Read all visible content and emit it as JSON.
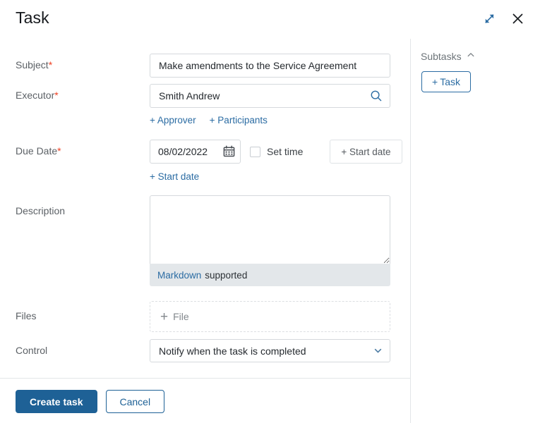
{
  "header": {
    "title": "Task",
    "expand_icon": "expand-diagonal-icon",
    "close_icon": "close-icon"
  },
  "form": {
    "subject": {
      "label": "Subject",
      "required_mark": "*",
      "value": "Make amendments to the Service Agreement",
      "placeholder": ""
    },
    "executor": {
      "label": "Executor",
      "required_mark": "*",
      "value": "Smith Andrew",
      "placeholder": "",
      "search_icon": "search-icon",
      "links": [
        {
          "label": "+ Approver"
        },
        {
          "label": "+ Participants"
        }
      ]
    },
    "due_date": {
      "label": "Due Date",
      "required_mark": "*",
      "value": "08/02/2022",
      "calendar_icon": "calendar-icon",
      "set_time_label": "Set time",
      "set_time_checked": false,
      "start_date_button": "+ Start date",
      "start_date_link": "+ Start date"
    },
    "description": {
      "label": "Description",
      "value": "",
      "placeholder": "",
      "markdown_link": "Markdown",
      "markdown_suffix": "supported"
    },
    "files": {
      "label": "Files",
      "add_file_label": "File",
      "plus_glyph": "+"
    },
    "control": {
      "label": "Control",
      "selected": "Notify when the task is completed",
      "chevron_icon": "chevron-down-icon"
    }
  },
  "footer": {
    "create_label": "Create task",
    "cancel_label": "Cancel"
  },
  "subtasks": {
    "title": "Subtasks",
    "collapse_icon": "chevron-up-icon",
    "add_task_plus": "+",
    "add_task_label": "Task"
  },
  "colors": {
    "primary": "#1e6196",
    "link": "#2b6ca3",
    "required": "#ef4123",
    "border": "#d5d9dd",
    "markdown_bar": "#e3e7ea"
  }
}
